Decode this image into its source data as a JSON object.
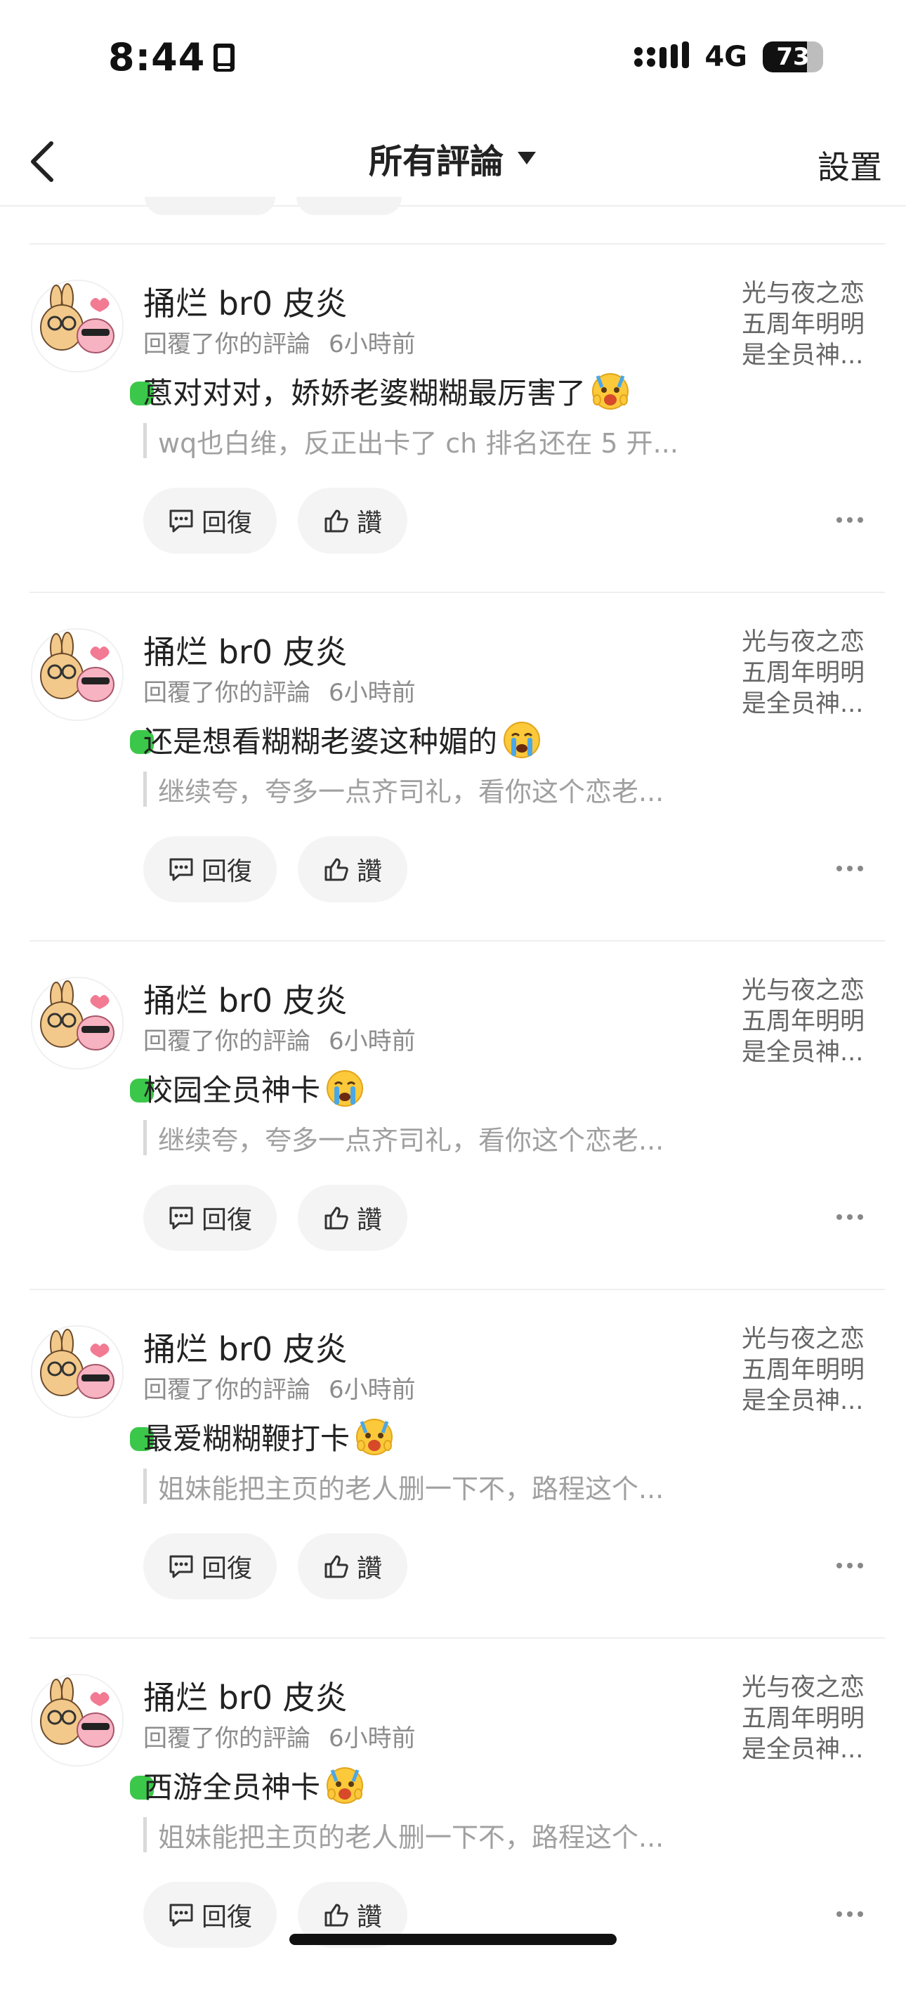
{
  "status_bar": {
    "time": "8:44",
    "network": "4G",
    "battery": "73",
    "battery_level": 0.73
  },
  "nav": {
    "title": "所有評論",
    "settings": "設置",
    "icons": {
      "back": "chevron-left-icon",
      "dropdown": "caret-down-icon"
    }
  },
  "colors": {
    "online": "#3bc84a",
    "chip_bg": "#f4f4f4",
    "quote_bar": "#d9d9d9",
    "meta_text": "#8c8c8c"
  },
  "comments": [
    {
      "username": "捅烂 br0 皮炎",
      "meta_label": "回覆了你的評論",
      "time": "6小時前",
      "text": "蒽对对对，娇娇老婆糊糊最厉害了",
      "emoji": "shocked-face",
      "quote": "wq也白维，反正出卡了 ch 排名还在 5 开...",
      "source": [
        "光与夜之恋",
        "五周年明明",
        "是全员神..."
      ],
      "reply_label": "回復",
      "like_label": "讚"
    },
    {
      "username": "捅烂 br0 皮炎",
      "meta_label": "回覆了你的評論",
      "time": "6小時前",
      "text": "还是想看糊糊老婆这种媚的",
      "emoji": "crying-face",
      "quote": "继续夸，夸多一点齐司礼，看你这个恋老...",
      "source": [
        "光与夜之恋",
        "五周年明明",
        "是全员神..."
      ],
      "reply_label": "回復",
      "like_label": "讚"
    },
    {
      "username": "捅烂 br0 皮炎",
      "meta_label": "回覆了你的評論",
      "time": "6小時前",
      "text": "校园全员神卡",
      "emoji": "crying-face",
      "quote": "继续夸，夸多一点齐司礼，看你这个恋老...",
      "source": [
        "光与夜之恋",
        "五周年明明",
        "是全员神..."
      ],
      "reply_label": "回復",
      "like_label": "讚"
    },
    {
      "username": "捅烂 br0 皮炎",
      "meta_label": "回覆了你的評論",
      "time": "6小時前",
      "text": "最爱糊糊鞭打卡",
      "emoji": "shocked-face",
      "quote": "姐妹能把主页的老人删一下不，路程这个...",
      "source": [
        "光与夜之恋",
        "五周年明明",
        "是全员神..."
      ],
      "reply_label": "回復",
      "like_label": "讚"
    },
    {
      "username": "捅烂 br0 皮炎",
      "meta_label": "回覆了你的評論",
      "time": "6小時前",
      "text": "西游全员神卡",
      "emoji": "shocked-face",
      "quote": "姐妹能把主页的老人删一下不，路程这个...",
      "source": [
        "光与夜之恋",
        "五周年明明",
        "是全员神..."
      ],
      "reply_label": "回復",
      "like_label": "讚"
    }
  ]
}
